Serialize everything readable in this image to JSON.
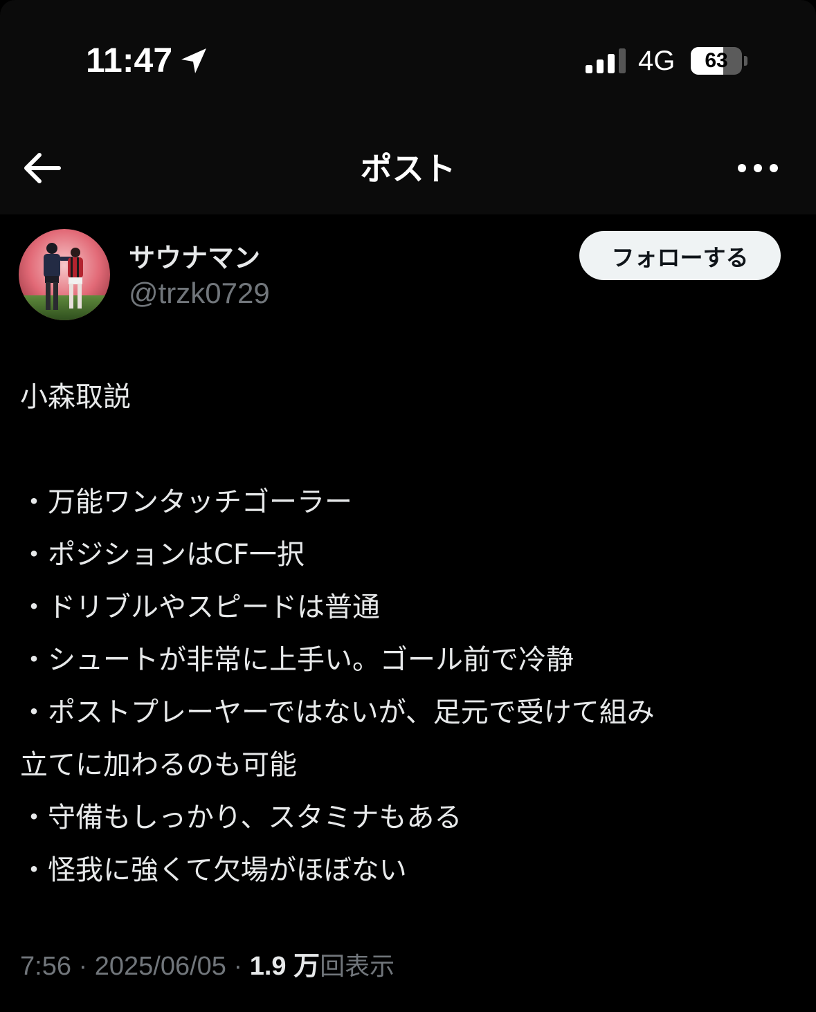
{
  "status_bar": {
    "time": "11:47",
    "network": "4G",
    "battery_level": "63",
    "battery_fraction": 0.63,
    "signal_bars": 3,
    "signal_bars_total": 4,
    "location_icon": "location-arrow-icon"
  },
  "nav": {
    "back_icon": "arrow-left-icon",
    "title": "ポスト",
    "more_icon": "more-horizontal-icon"
  },
  "author": {
    "display_name": "サウナマン",
    "handle": "@trzk0729",
    "follow_label": "フォローする"
  },
  "post": {
    "title_line": "小森取説",
    "lines": [
      "・万能ワンタッチゴーラー",
      "・ポジションはCF一択",
      "・ドリブルやスピードは普通",
      "・シュートが非常に上手い。ゴール前で冷静",
      "・ポストプレーヤーではないが、足元で受けて組み",
      "立てに加わるのも可能",
      "・守備もしっかり、スタミナもある",
      "・怪我に強くて欠場がほぼない"
    ]
  },
  "meta": {
    "time": "7:56",
    "separator": "·",
    "date": "2025/06/05",
    "views_count": "1.9 万",
    "views_label": "回表示"
  },
  "colors": {
    "background": "#000000",
    "bar_background": "#0b0b0b",
    "text_primary": "#e7e9ea",
    "text_secondary": "#71767b",
    "follow_button_bg": "#eff3f4",
    "follow_button_text": "#0f1419"
  }
}
